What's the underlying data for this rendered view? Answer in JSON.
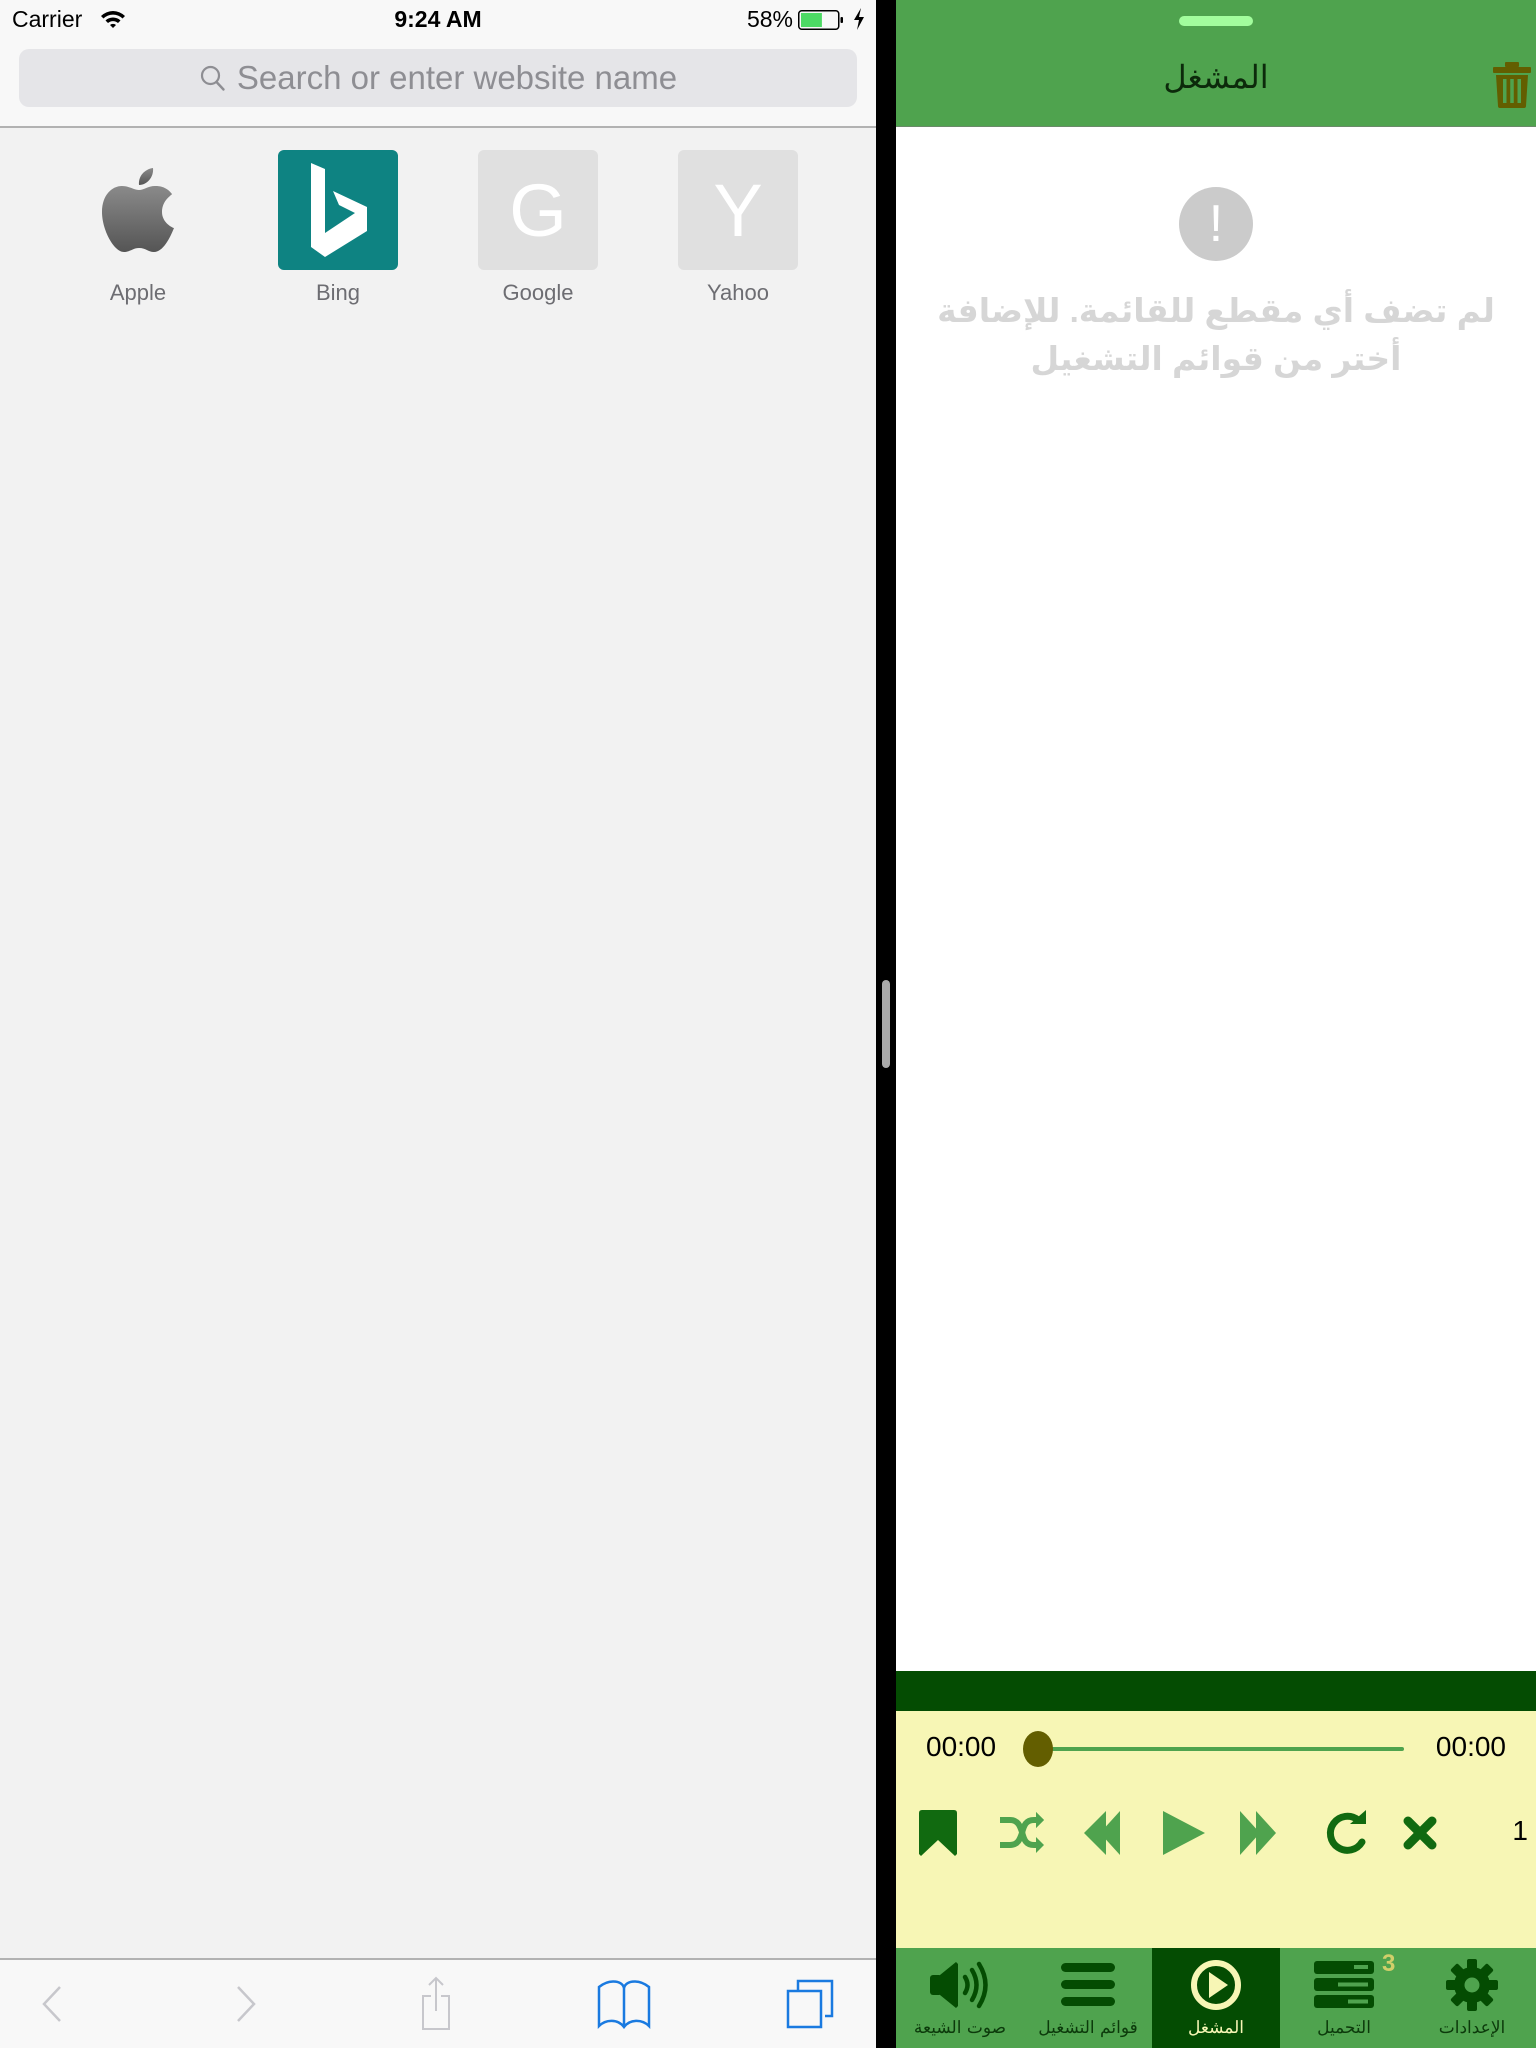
{
  "status_bar": {
    "carrier": "Carrier",
    "time": "9:24 AM",
    "battery_percent": "58%",
    "battery_level": 0.58,
    "charging": true
  },
  "safari": {
    "search": {
      "placeholder": "Search or enter website name",
      "value": ""
    },
    "favorites": [
      {
        "label": "Apple",
        "icon": "apple-logo-icon"
      },
      {
        "label": "Bing",
        "icon": "bing-logo-icon",
        "color": "#0e8382"
      },
      {
        "label": "Google",
        "letter": "G",
        "color": "#e0e0e0"
      },
      {
        "label": "Yahoo",
        "letter": "Y",
        "color": "#e0e0e0"
      }
    ],
    "toolbar": {
      "back": "chevron-left-icon",
      "forward": "chevron-right-icon",
      "share": "share-icon",
      "bookmarks": "book-icon",
      "tabs": "tabs-icon"
    }
  },
  "app": {
    "title": "المشغل",
    "trash": "trash-icon",
    "empty_state": {
      "icon": "!",
      "message": "لم تضف أي مقطع للقائمة. للإضافة أختر من قوائم التشغيل"
    },
    "player": {
      "current_time": "00:00",
      "total_time": "00:00",
      "progress": 0,
      "speed": "1",
      "controls": [
        "bookmark",
        "shuffle",
        "rewind",
        "play",
        "fast-forward",
        "repeat",
        "close"
      ]
    },
    "tabs": [
      {
        "label": "صوت الشيعة",
        "icon": "speaker-icon",
        "active": false
      },
      {
        "label": "قوائم التشغيل",
        "icon": "list-icon",
        "active": false
      },
      {
        "label": "المشغل",
        "icon": "play-circle-icon",
        "active": true
      },
      {
        "label": "التحميل",
        "icon": "downloads-icon",
        "active": false,
        "badge": "3"
      },
      {
        "label": "الإعدادات",
        "icon": "gear-icon",
        "active": false
      }
    ],
    "colors": {
      "header_green": "#4fa34e",
      "dark_green": "#044c02",
      "player_bg": "#f7f6b5",
      "icon_dark": "#116a10",
      "icon_light": "#4fa34e",
      "thumb": "#635e00"
    }
  }
}
